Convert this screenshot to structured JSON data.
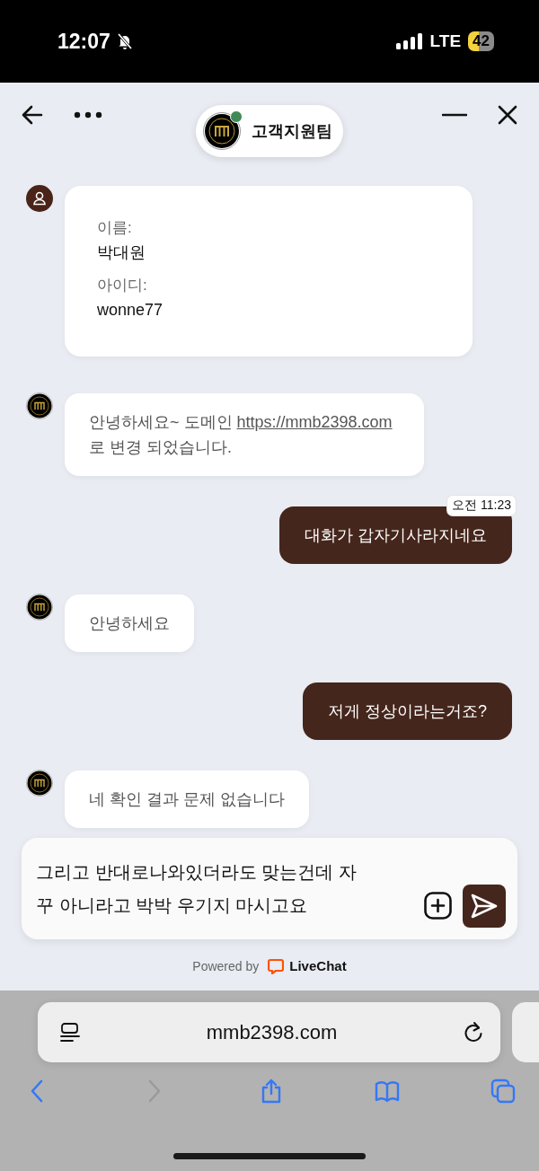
{
  "status_bar": {
    "time": "12:07",
    "silent": true,
    "network": "LTE",
    "battery": "42"
  },
  "header": {
    "title": "고객지원팀",
    "online": true
  },
  "messages": [
    {
      "kind": "details",
      "fields": [
        {
          "label": "이름:",
          "value": "박대원"
        },
        {
          "label": "아이디:",
          "value": "wonne77"
        }
      ]
    },
    {
      "kind": "agent",
      "text_before": "안녕하세요~ 도메인 ",
      "link": "https://mmb2398.com",
      "text_after": " 로 변경 되었습니다."
    },
    {
      "kind": "visitor",
      "text": "대화가 갑자기사라지네요",
      "time": "오전 11:23"
    },
    {
      "kind": "agent",
      "text": "안녕하세요"
    },
    {
      "kind": "visitor",
      "text": "저게 정상이라는거죠?"
    },
    {
      "kind": "agent",
      "text": "네 확인 결과 문제 없습니다"
    }
  ],
  "composer": {
    "value": "그리고 반대로나와있더라도 맞는건데 자꾸 아니라고 박박 우기지 마시고요"
  },
  "powered": {
    "prefix": "Powered by",
    "brand": "LiveChat"
  },
  "browser": {
    "url": "mmb2398.com",
    "nav_buttons": [
      {
        "kind": "back",
        "disabled": false
      },
      {
        "kind": "forward",
        "disabled": true
      },
      {
        "kind": "share",
        "disabled": false
      },
      {
        "kind": "bookmarks",
        "disabled": false
      },
      {
        "kind": "tabs",
        "disabled": false
      }
    ]
  }
}
